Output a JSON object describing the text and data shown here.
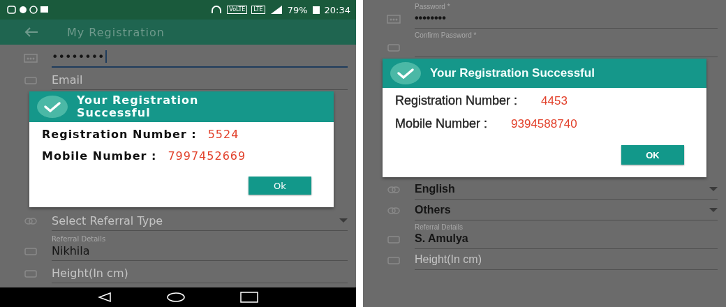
{
  "screens": [
    {
      "status_bar": {
        "badges": [
          "VoLTE",
          "LTE"
        ],
        "battery": "79%",
        "time": "20:34"
      },
      "app_bar": {
        "title": "My Registration"
      },
      "fields_above": [
        {
          "kind": "password",
          "value": "••••••••",
          "focused": true
        },
        {
          "kind": "input",
          "placeholder": "Email"
        }
      ],
      "dialog": {
        "title": "Your Registration Successful",
        "rows": [
          {
            "label": "Registration Number :",
            "value": "5524"
          },
          {
            "label": "Mobile Number :",
            "value": "7997452669"
          }
        ],
        "button": "Ok"
      },
      "fields_below": [
        {
          "kind": "dropdown",
          "placeholder": "Select Referral Type"
        },
        {
          "kind": "input",
          "label": "Referral Details",
          "value": "Nikhila"
        },
        {
          "kind": "input",
          "placeholder": "Height(In cm)"
        }
      ]
    },
    {
      "fields_above": [
        {
          "kind": "password",
          "label": "Password *",
          "value": "••••••••",
          "focused": false
        },
        {
          "kind": "input",
          "label": "Confirm Password *"
        }
      ],
      "dialog": {
        "title": "Your Registration Successful",
        "rows": [
          {
            "label": "Registration Number :",
            "value": "4453"
          },
          {
            "label": "Mobile Number :",
            "value": "9394588740"
          }
        ],
        "button": "OK"
      },
      "fields_below": [
        {
          "kind": "dropdown",
          "value": "English"
        },
        {
          "kind": "dropdown",
          "value": "Others"
        },
        {
          "kind": "input",
          "label": "Referral Details",
          "value": "S. Amulya"
        },
        {
          "kind": "input",
          "placeholder": "Height(In cm)"
        }
      ]
    }
  ]
}
